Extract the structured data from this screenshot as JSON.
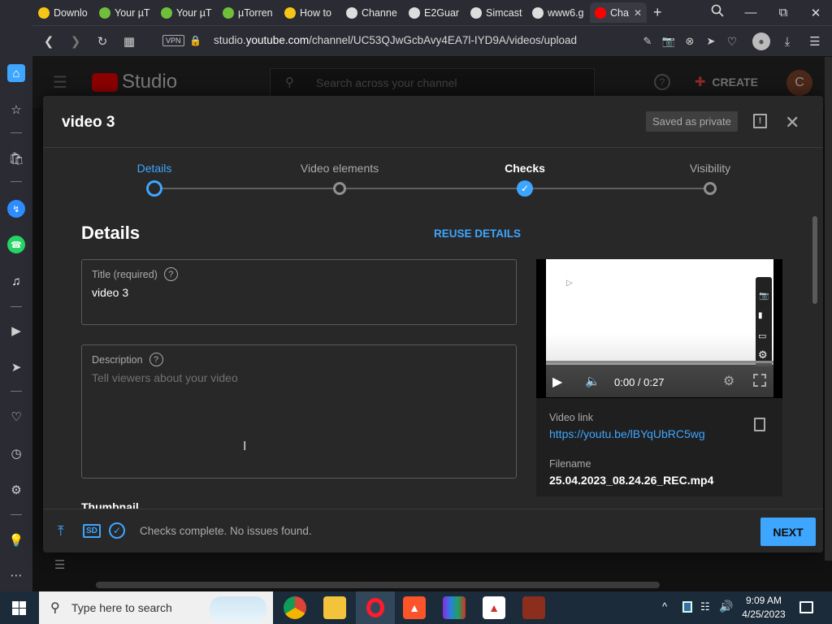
{
  "browser": {
    "tabs": [
      {
        "label": "Downlo",
        "color": "#f5c518"
      },
      {
        "label": "Your µT",
        "color": "#6fbf3a"
      },
      {
        "label": "Your µT",
        "color": "#6fbf3a"
      },
      {
        "label": "µTorren",
        "color": "#6fbf3a"
      },
      {
        "label": "How to",
        "color": "#f5c518"
      },
      {
        "label": "Channe",
        "color": "#dddddd"
      },
      {
        "label": "E2Guar",
        "color": "#dddddd"
      },
      {
        "label": "Simcast",
        "color": "#dddddd"
      },
      {
        "label": "www6.g",
        "color": "#dddddd"
      },
      {
        "label": "Cha",
        "color": "#ff0000"
      }
    ],
    "url_prefix": "studio.",
    "url_domain": "youtube.com",
    "url_path": "/channel/UC53QJwGcbAvy4EA7l-IYD9A/videos/upload",
    "vpn_label": "VPN"
  },
  "studio": {
    "logo_text": "Studio",
    "search_placeholder": "Search across your channel",
    "create_label": "CREATE",
    "avatar_letter": "C"
  },
  "dialog": {
    "title": "video 3",
    "saved_badge": "Saved as private",
    "steps": [
      {
        "label": "Details",
        "state": "current"
      },
      {
        "label": "Video elements",
        "state": "pending"
      },
      {
        "label": "Checks",
        "state": "done"
      },
      {
        "label": "Visibility",
        "state": "pending"
      }
    ],
    "section_heading": "Details",
    "reuse_label": "REUSE DETAILS",
    "title_field": {
      "label": "Title (required)",
      "value": "video 3"
    },
    "description_field": {
      "label": "Description",
      "placeholder": "Tell viewers about your video"
    },
    "thumbnail_heading": "Thumbnail",
    "preview": {
      "time": "0:00 / 0:27",
      "video_link_label": "Video link",
      "video_link": "https://youtu.be/lBYqUbRC5wg",
      "filename_label": "Filename",
      "filename": "25.04.2023_08.24.26_REC.mp4"
    },
    "footer": {
      "sd_badge": "SD",
      "status": "Checks complete. No issues found.",
      "next_label": "NEXT"
    }
  },
  "taskbar": {
    "search_placeholder": "Type here to search",
    "time": "9:09 AM",
    "date": "4/25/2023"
  },
  "colors": {
    "accent": "#3ea6ff",
    "youtube_red": "#ff0000"
  }
}
